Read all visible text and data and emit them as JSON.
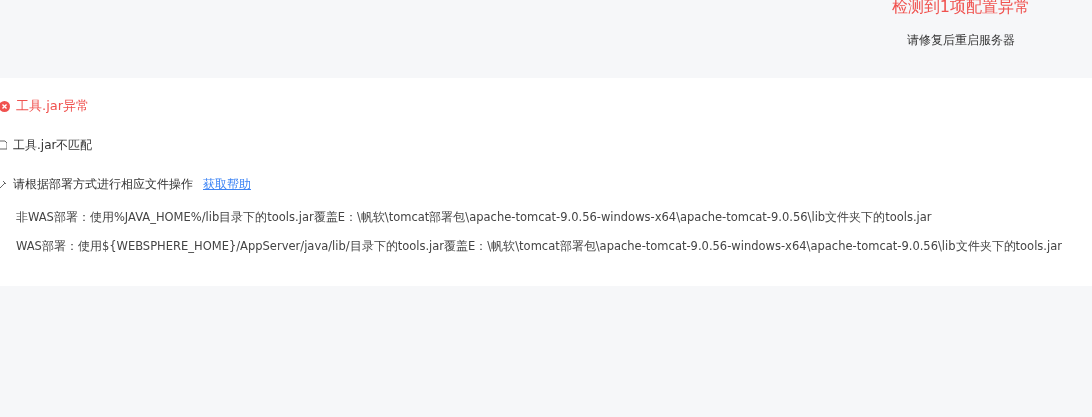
{
  "header": {
    "title": "检测到1项配置异常",
    "subtitle": "请修复后重启服务器"
  },
  "issue": {
    "title": "工具.jar异常",
    "reason": "工具.jar不匹配",
    "instruction": "请根据部署方式进行相应文件操作",
    "help_link": "获取帮助",
    "steps": [
      "非WAS部署：使用%JAVA_HOME%/lib目录下的tools.jar覆盖E：\\帆软\\tomcat部署包\\apache-tomcat-9.0.56-windows-x64\\apache-tomcat-9.0.56\\lib文件夹下的tools.jar",
      "WAS部署：使用${WEBSPHERE_HOME}/AppServer/java/lib/目录下的tools.jar覆盖E：\\帆软\\tomcat部署包\\apache-tomcat-9.0.56-windows-x64\\apache-tomcat-9.0.56\\lib文件夹下的tools.jar"
    ]
  }
}
